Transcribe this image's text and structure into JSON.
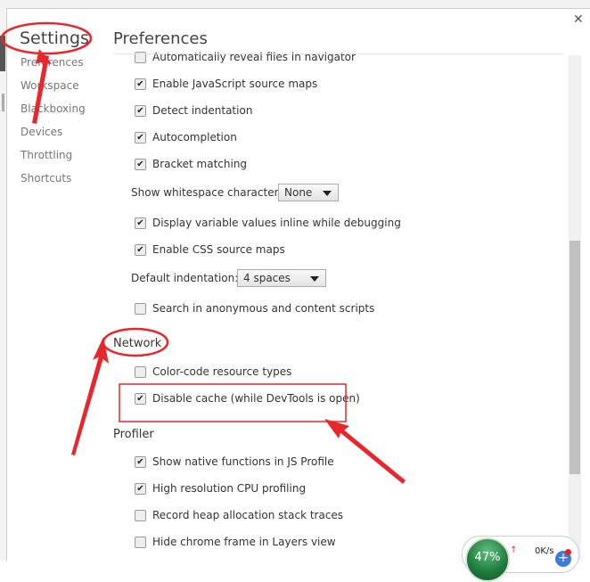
{
  "sidebar": {
    "title": "Settings",
    "items": [
      {
        "label": "Preferences"
      },
      {
        "label": "Workspace"
      },
      {
        "label": "Blackboxing"
      },
      {
        "label": "Devices"
      },
      {
        "label": "Throttling"
      },
      {
        "label": "Shortcuts"
      }
    ]
  },
  "main": {
    "title": "Preferences",
    "close_icon": "close-icon",
    "rows": [
      {
        "label": "Automatically reveal files in navigator",
        "checked": false
      },
      {
        "label": "Enable JavaScript source maps",
        "checked": true
      },
      {
        "label": "Detect indentation",
        "checked": true
      },
      {
        "label": "Autocompletion",
        "checked": true
      },
      {
        "label": "Bracket matching",
        "checked": true
      }
    ],
    "whitespace": {
      "label": "Show whitespace characters:",
      "value": "None"
    },
    "rows2": [
      {
        "label": "Display variable values inline while debugging",
        "checked": true
      },
      {
        "label": "Enable CSS source maps",
        "checked": true
      }
    ],
    "indentation": {
      "label": "Default indentation:",
      "value": "4 spaces"
    },
    "search_anon": {
      "label": "Search in anonymous and content scripts",
      "checked": false
    },
    "network": {
      "title": "Network",
      "rows": [
        {
          "label": "Color-code resource types",
          "checked": false
        },
        {
          "label": "Disable cache (while DevTools is open)",
          "checked": true
        }
      ]
    },
    "profiler": {
      "title": "Profiler",
      "rows": [
        {
          "label": "Show native functions in JS Profile",
          "checked": true
        },
        {
          "label": "High resolution CPU profiling",
          "checked": true
        },
        {
          "label": "Record heap allocation stack traces",
          "checked": false
        },
        {
          "label": "Hide chrome frame in Layers view",
          "checked": false
        }
      ]
    }
  },
  "widget": {
    "percent": "47%",
    "speed": "0K/s",
    "accent": "#1e7a3c"
  },
  "annotation_color": "#e8262b"
}
